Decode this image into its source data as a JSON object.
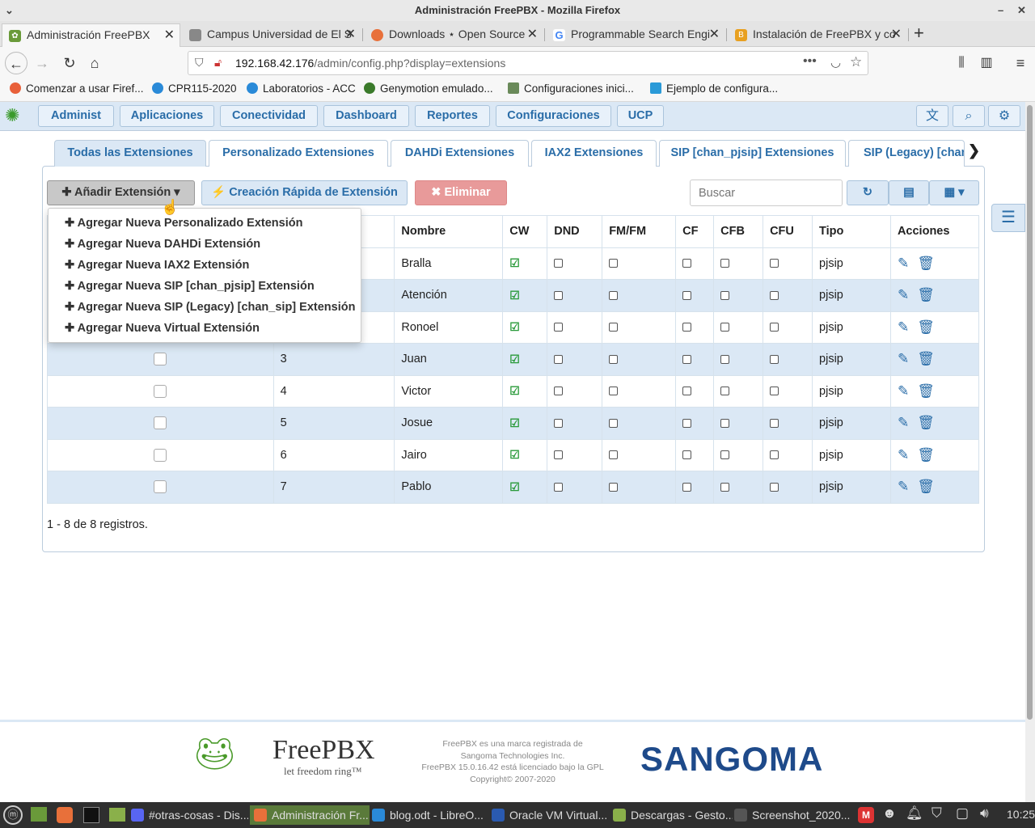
{
  "window": {
    "title": "Administración FreePBX - Mozilla Firefox"
  },
  "tabs": [
    {
      "label": "Administración FreePBX",
      "color": "#6a9a3a"
    },
    {
      "label": "Campus Universidad de El S",
      "color": "#888"
    },
    {
      "label": "Downloads ⋆ Open Source",
      "color": "#e8703a"
    },
    {
      "label": "Programmable Search Engi",
      "color": "#4285f4"
    },
    {
      "label": "Instalación de FreePBX y co",
      "color": "#e8a020"
    }
  ],
  "url": {
    "host": "192.168.42.176",
    "path": "/admin/config.php?display=extensions"
  },
  "bookmarks": [
    "Comenzar a usar Firef...",
    "CPR115-2020",
    "Laboratorios - ACC",
    "Genymotion emulado...",
    "Configuraciones inici...",
    "Ejemplo de configura..."
  ],
  "menu": [
    "Administ",
    "Aplicaciones",
    "Conectividad",
    "Dashboard",
    "Reportes",
    "Configuraciones",
    "UCP"
  ],
  "ext_tabs": [
    "Todas las Extensiones",
    "Personalizado Extensiones",
    "DAHDi Extensiones",
    "IAX2 Extensiones",
    "SIP [chan_pjsip] Extensiones",
    "SIP (Legacy) [chan"
  ],
  "toolbar": {
    "add": "✚ Añadir Extensión ▾",
    "quick": "⚡ Creación Rápida de Extensión",
    "delete": "✖ Eliminar",
    "search_placeholder": "Buscar"
  },
  "dropdown": [
    "Agregar Nueva Personalizado Extensión",
    "Agregar Nueva DAHDi Extensión",
    "Agregar Nueva IAX2 Extensión",
    "Agregar Nueva SIP [chan_pjsip] Extensión",
    "Agregar Nueva SIP (Legacy) [chan_sip] Extensión",
    "Agregar Nueva Virtual Extensión"
  ],
  "columns": [
    "Nombre",
    "CW",
    "DND",
    "FM/FM",
    "CF",
    "CFB",
    "CFU",
    "Tipo",
    "Acciones"
  ],
  "rows": [
    {
      "ext": "",
      "name": "Bralla",
      "type": "pjsip"
    },
    {
      "ext": "",
      "name": "Atención",
      "type": "pjsip"
    },
    {
      "ext": "",
      "name": "Ronoel",
      "type": "pjsip"
    },
    {
      "ext": "3",
      "name": "Juan",
      "type": "pjsip"
    },
    {
      "ext": "4",
      "name": "Victor",
      "type": "pjsip"
    },
    {
      "ext": "5",
      "name": "Josue",
      "type": "pjsip"
    },
    {
      "ext": "6",
      "name": "Jairo",
      "type": "pjsip"
    },
    {
      "ext": "7",
      "name": "Pablo",
      "type": "pjsip"
    }
  ],
  "records": "1 - 8 de 8 registros.",
  "footer": {
    "brand": "FreePBX",
    "tagline": "let freedom ring™",
    "legal1": "FreePBX es una marca registrada de",
    "legal2": "Sangoma Technologies Inc.",
    "legal3": "FreePBX 15.0.16.42 está licenciado bajo la GPL",
    "legal4": "Copyright© 2007-2020",
    "sangoma": "SANGOMA"
  },
  "taskbar": [
    "#otras-cosas - Dis...",
    "Administración Fr...",
    "blog.odt - LibreO...",
    "Oracle VM Virtual...",
    "Descargas - Gesto...",
    "Screenshot_2020..."
  ],
  "clock": "10:25"
}
